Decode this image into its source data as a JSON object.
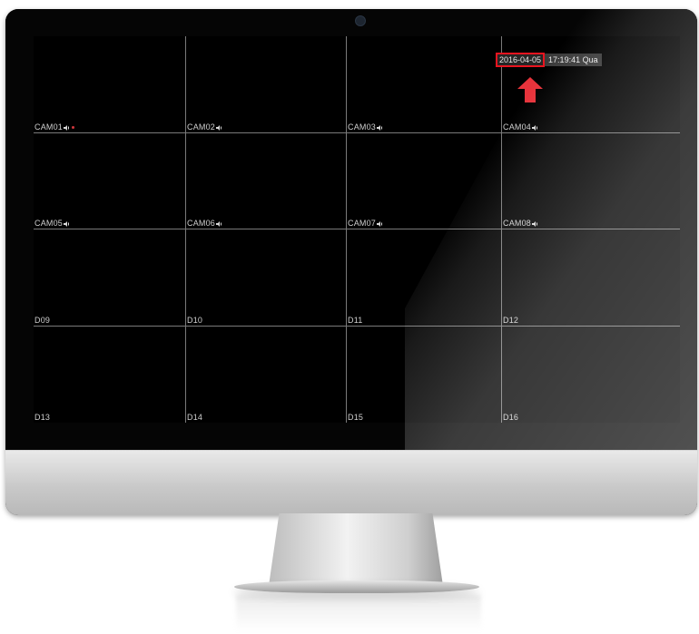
{
  "datetime": {
    "date": "2016-04-05",
    "time_day": "17:19:41 Qua"
  },
  "cells": [
    {
      "label": "CAM01",
      "audio": true,
      "rec": true
    },
    {
      "label": "CAM02",
      "audio": true,
      "rec": false
    },
    {
      "label": "CAM03",
      "audio": true,
      "rec": false
    },
    {
      "label": "CAM04",
      "audio": true,
      "rec": false
    },
    {
      "label": "CAM05",
      "audio": true,
      "rec": false
    },
    {
      "label": "CAM06",
      "audio": true,
      "rec": false
    },
    {
      "label": "CAM07",
      "audio": true,
      "rec": false
    },
    {
      "label": "CAM08",
      "audio": true,
      "rec": false
    },
    {
      "label": "D09",
      "audio": false,
      "rec": false
    },
    {
      "label": "D10",
      "audio": false,
      "rec": false
    },
    {
      "label": "D11",
      "audio": false,
      "rec": false
    },
    {
      "label": "D12",
      "audio": false,
      "rec": false
    },
    {
      "label": "D13",
      "audio": false,
      "rec": false
    },
    {
      "label": "D14",
      "audio": false,
      "rec": false
    },
    {
      "label": "D15",
      "audio": false,
      "rec": false
    },
    {
      "label": "D16",
      "audio": false,
      "rec": false
    }
  ],
  "colors": {
    "highlight": "#e8141f",
    "arrow": "#e8333b",
    "rec_dot": "#d2373d",
    "grid_line": "#7a7a7a"
  },
  "icons": {
    "audio": "speaker-icon",
    "arrow": "up-arrow-icon",
    "camera": "webcam-icon"
  }
}
